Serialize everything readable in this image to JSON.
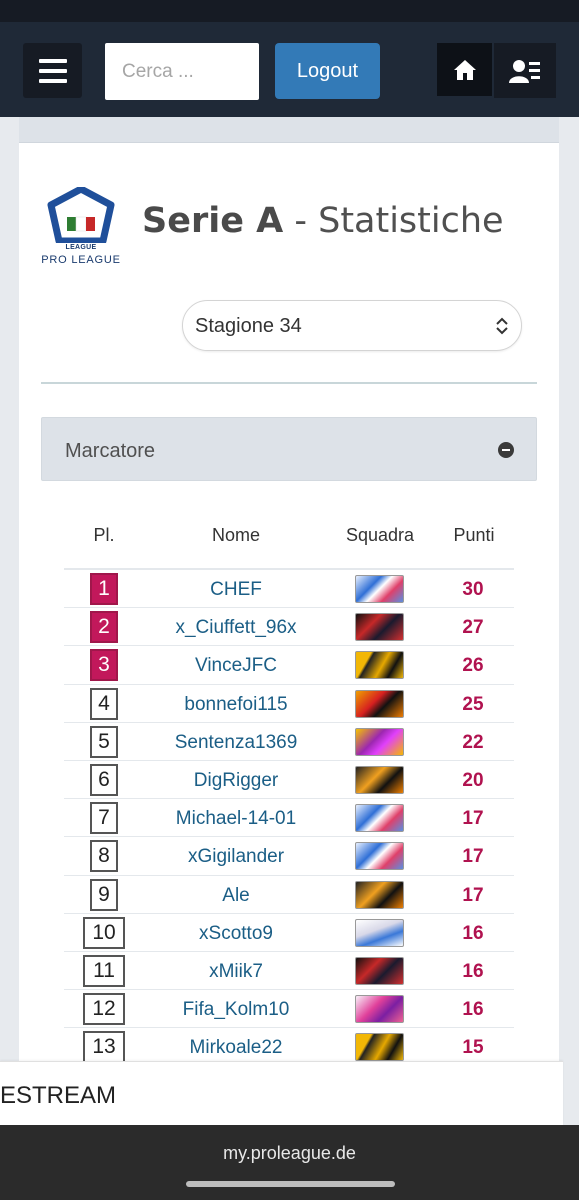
{
  "navbar": {
    "search_placeholder": "Cerca ...",
    "logout_label": "Logout"
  },
  "page": {
    "title_bold": "Serie A",
    "title_rest": " - Statistiche",
    "logo_line1": "LEAGUE",
    "logo_line2": "PRO LEAGUE",
    "season_selected": "Stagione 34"
  },
  "section": {
    "title": "Marcatore"
  },
  "table": {
    "headers": {
      "rank": "Pl.",
      "name": "Nome",
      "team": "Squadra",
      "points": "Punti"
    },
    "rows": [
      {
        "rank": "1",
        "name": "CHEF",
        "points": "30",
        "team_icon": "team-crest-white-blue"
      },
      {
        "rank": "2",
        "name": "x_Ciuffett_96x",
        "points": "27",
        "team_icon": "team-crest-red-black"
      },
      {
        "rank": "3",
        "name": "VinceJFC",
        "points": "26",
        "team_icon": "team-crest-yellow-black"
      },
      {
        "rank": "4",
        "name": "bonnefoi115",
        "points": "25",
        "team_icon": "team-crest-red-orange"
      },
      {
        "rank": "5",
        "name": "Sentenza1369",
        "points": "22",
        "team_icon": "team-crest-purple-yellow"
      },
      {
        "rank": "6",
        "name": "DigRigger",
        "points": "20",
        "team_icon": "team-crest-orange-black"
      },
      {
        "rank": "7",
        "name": "Michael-14-01",
        "points": "17",
        "team_icon": "team-crest-white-blue"
      },
      {
        "rank": "8",
        "name": "xGigilander",
        "points": "17",
        "team_icon": "team-crest-white-blue"
      },
      {
        "rank": "9",
        "name": "Ale",
        "points": "17",
        "team_icon": "team-crest-orange-black"
      },
      {
        "rank": "10",
        "name": "xScotto9",
        "points": "16",
        "team_icon": "team-crest-white-blue-light"
      },
      {
        "rank": "11",
        "name": "xMiik7",
        "points": "16",
        "team_icon": "team-crest-red-black"
      },
      {
        "rank": "12",
        "name": "Fifa_Kolm10",
        "points": "16",
        "team_icon": "team-crest-pink-purple"
      },
      {
        "rank": "13",
        "name": "Mirkoale22",
        "points": "15",
        "team_icon": "team-crest-yellow-black"
      }
    ]
  },
  "banner": {
    "text": "ESTREAM"
  },
  "browser": {
    "url": "my.proleague.de"
  },
  "colors": {
    "navbar": "#1f2937",
    "logout": "#337ab7",
    "rank_highlight": "#c2185b",
    "points": "#b0124f",
    "player_link": "#1b5e86"
  }
}
